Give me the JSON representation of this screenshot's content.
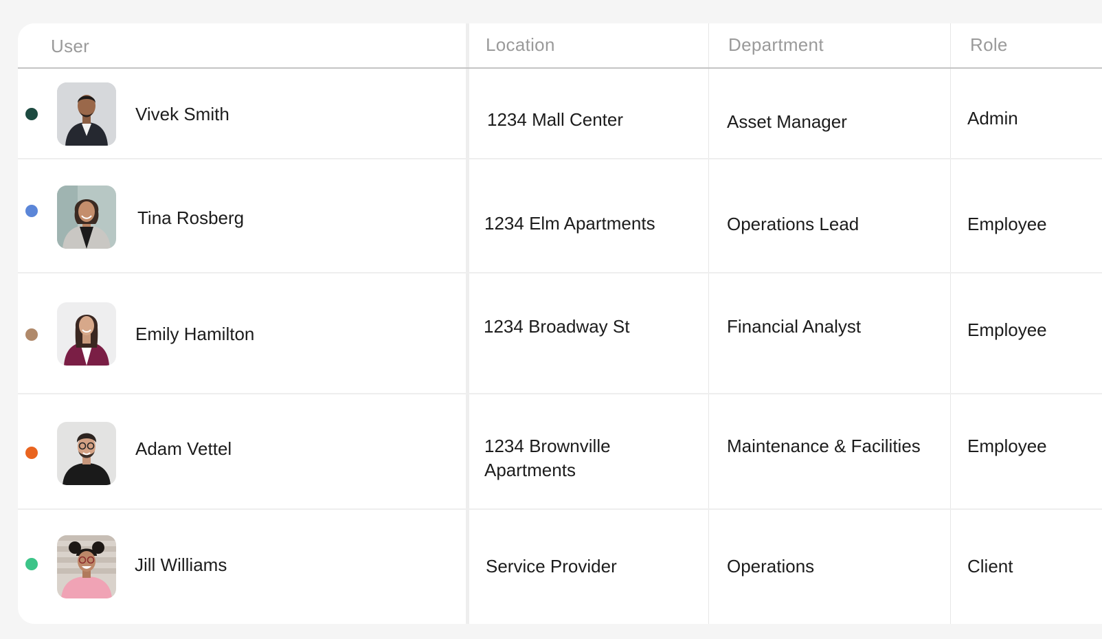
{
  "table": {
    "headers": {
      "user": "User",
      "location": "Location",
      "department": "Department",
      "role": "Role"
    },
    "rows": [
      {
        "name": "Vivek Smith",
        "location": "1234 Mall Center",
        "department": "Asset Manager",
        "role": "Admin",
        "status_color": "#1d4a40"
      },
      {
        "name": "Tina Rosberg",
        "location": "1234 Elm Apartments",
        "department": "Operations Lead",
        "role": "Employee",
        "status_color": "#5b86d8"
      },
      {
        "name": "Emily Hamilton",
        "location": "1234 Broadway St",
        "department": "Financial Analyst",
        "role": "Employee",
        "status_color": "#b0896a"
      },
      {
        "name": "Adam Vettel",
        "location": "1234 Brownville Apartments",
        "department": "Maintenance & Facilities",
        "role": "Employee",
        "status_color": "#e9641f"
      },
      {
        "name": "Jill Williams",
        "location": "Service Provider",
        "department": "Operations",
        "role": "Client",
        "status_color": "#3cc488"
      }
    ]
  }
}
